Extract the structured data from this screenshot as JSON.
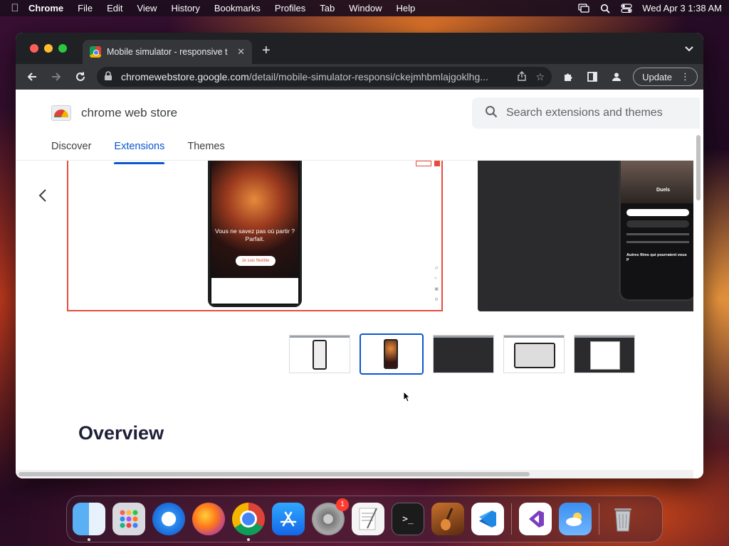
{
  "menubar": {
    "app_name": "Chrome",
    "items": [
      "File",
      "Edit",
      "View",
      "History",
      "Bookmarks",
      "Profiles",
      "Tab",
      "Window",
      "Help"
    ],
    "datetime": "Wed Apr 3  1:38 AM"
  },
  "browser": {
    "tab_title": "Mobile simulator - responsive t",
    "url_host": "chromewebstore.google.com",
    "url_path": "/detail/mobile-simulator-responsi/ckejmhbmlajgoklhg...",
    "update_label": "Update"
  },
  "store": {
    "name": "chrome web store",
    "search_placeholder": "Search extensions and themes",
    "nav": [
      "Discover",
      "Extensions",
      "Themes"
    ],
    "active_nav": "Extensions",
    "slide_main_text": "Vous ne savez pas où partir ? Parfait.",
    "slide_main_cta": "Je suis flexible",
    "slide_next_title": "Duels",
    "slide_next_subtitle": "Autres films qui pourraient vous p",
    "thumbnails_count": 5,
    "selected_thumbnail": 2,
    "overview_heading": "Overview"
  },
  "dock": {
    "apps": [
      "Finder",
      "Launchpad",
      "Safari",
      "Firefox",
      "Chrome",
      "App Store",
      "System Settings",
      "TextEdit",
      "Terminal",
      "Instruments",
      "Visual Studio Code",
      "Visual Studio",
      "Weather",
      "Trash"
    ],
    "settings_badge": "1"
  }
}
